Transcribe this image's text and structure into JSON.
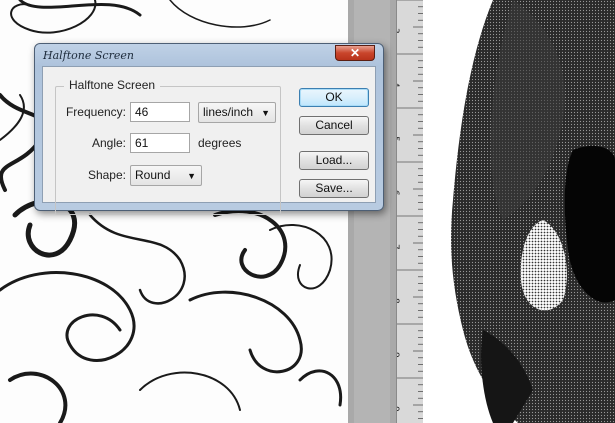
{
  "dialog": {
    "title": "Halftone Screen",
    "close_label": "✕",
    "group_label": "Halftone Screen",
    "frequency": {
      "label": "Frequency:",
      "value": "46",
      "unit": "lines/inch"
    },
    "angle": {
      "label": "Angle:",
      "value": "61",
      "unit": "degrees"
    },
    "shape": {
      "label": "Shape:",
      "value": "Round"
    },
    "buttons": {
      "ok": "OK",
      "cancel": "Cancel",
      "load": "Load...",
      "save": "Save..."
    }
  },
  "ruler": {
    "numbers": [
      "3",
      "4",
      "5",
      "6",
      "7",
      "8",
      "9",
      "0"
    ]
  }
}
